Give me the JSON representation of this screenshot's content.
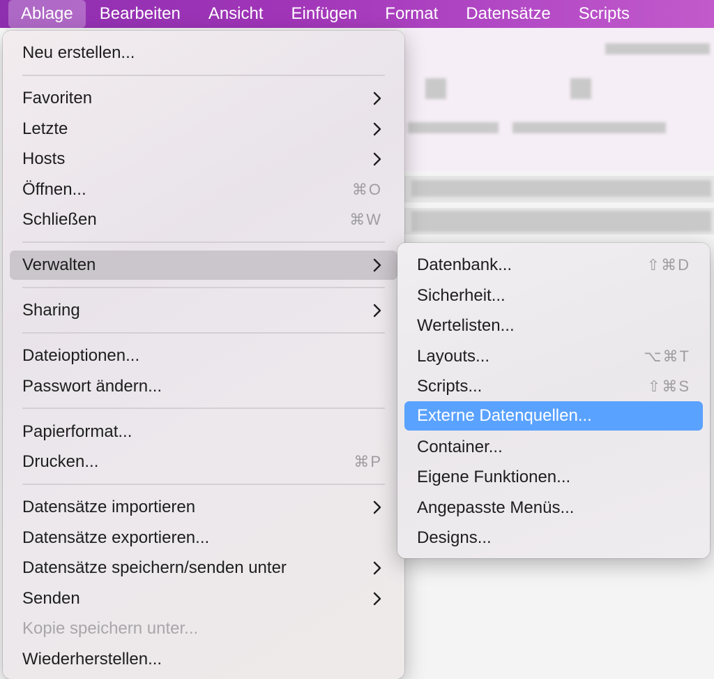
{
  "menubar": {
    "items": [
      "Ablage",
      "Bearbeiten",
      "Ansicht",
      "Einfügen",
      "Format",
      "Datensätze",
      "Scripts"
    ]
  },
  "file_menu": {
    "items": [
      {
        "label": "Neu erstellen..."
      },
      {
        "label": "Favoriten",
        "icon": "chevron-right-icon"
      },
      {
        "label": "Letzte",
        "icon": "chevron-right-icon"
      },
      {
        "label": "Hosts",
        "icon": "chevron-right-icon"
      },
      {
        "label": "Öffnen...",
        "shortcut": "⌘O"
      },
      {
        "label": "Schließen",
        "shortcut": "⌘W"
      },
      {
        "label": "Verwalten",
        "icon": "chevron-right-icon"
      },
      {
        "label": "Sharing",
        "icon": "chevron-right-icon"
      },
      {
        "label": "Dateioptionen..."
      },
      {
        "label": "Passwort ändern..."
      },
      {
        "label": "Papierformat..."
      },
      {
        "label": "Drucken...",
        "shortcut": "⌘P"
      },
      {
        "label": "Datensätze importieren",
        "icon": "chevron-right-icon"
      },
      {
        "label": "Datensätze exportieren..."
      },
      {
        "label": "Datensätze speichern/senden unter",
        "icon": "chevron-right-icon"
      },
      {
        "label": "Senden",
        "icon": "chevron-right-icon"
      },
      {
        "label": "Kopie speichern unter..."
      },
      {
        "label": "Wiederherstellen..."
      }
    ]
  },
  "manage_submenu": {
    "items": [
      {
        "label": "Datenbank...",
        "shortcut": "⇧⌘D"
      },
      {
        "label": "Sicherheit..."
      },
      {
        "label": "Wertelisten..."
      },
      {
        "label": "Layouts...",
        "shortcut": "⌥⌘T"
      },
      {
        "label": "Scripts...",
        "shortcut": "⇧⌘S"
      },
      {
        "label": "Externe Datenquellen..."
      },
      {
        "label": "Container..."
      },
      {
        "label": "Eigene Funktionen..."
      },
      {
        "label": "Angepasste Menüs..."
      },
      {
        "label": "Designs..."
      }
    ]
  },
  "colors": {
    "menubar": "#a135b8",
    "selection": "#5aa2ff",
    "highlight": "#cbc6cc"
  }
}
